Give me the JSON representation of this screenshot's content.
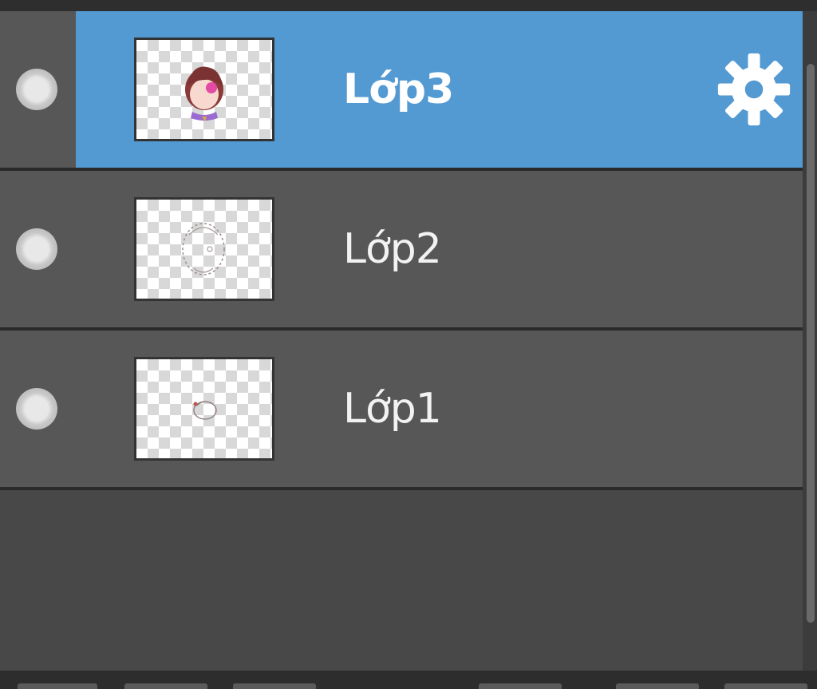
{
  "layers_panel": {
    "layers": [
      {
        "name": "Lớp3",
        "selected": true,
        "thumbnail": "character-face"
      },
      {
        "name": "Lớp2",
        "selected": false,
        "thumbnail": "sketch-outline"
      },
      {
        "name": "Lớp1",
        "selected": false,
        "thumbnail": "small-sketch"
      }
    ],
    "icons": {
      "visibility": "visibility-dot-icon",
      "settings": "gear-icon"
    },
    "colors": {
      "selected_row": "#5399d2",
      "row": "#575757",
      "panel_background": "#464646",
      "text": "#f2f2f2"
    }
  }
}
